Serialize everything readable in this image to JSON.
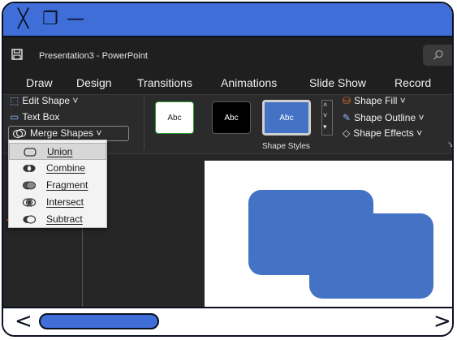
{
  "window": {
    "close_glyph": "╳",
    "restore_glyph": "❐",
    "minimize_glyph": "—",
    "title": "Presentation3  -  PowerPoint"
  },
  "tabs": [
    "Draw",
    "Design",
    "Transitions",
    "Animations",
    "Slide Show",
    "Record"
  ],
  "ribbon": {
    "edit_shape": "Edit Shape ˅",
    "text_box": "Text Box",
    "merge_shapes": "Merge Shapes ˅",
    "style_thumbs": [
      "Abc",
      "Abc",
      "Abc"
    ],
    "shape_fill": "Shape Fill ˅",
    "shape_outline": "Shape Outline ˅",
    "shape_effects": "Shape Effects ˅",
    "group_label": "Shape Styles"
  },
  "merge_menu": {
    "items": [
      "Union",
      "Combine",
      "Fragment",
      "Intersect",
      "Subtract"
    ],
    "highlighted": "Union"
  },
  "scroll": {
    "left_arrow": "<",
    "right_arrow": ">"
  },
  "colors": {
    "accent": "#3f6ed8",
    "shape_fill": "#4472c4",
    "ribbon_bg": "#2b2b2b"
  }
}
